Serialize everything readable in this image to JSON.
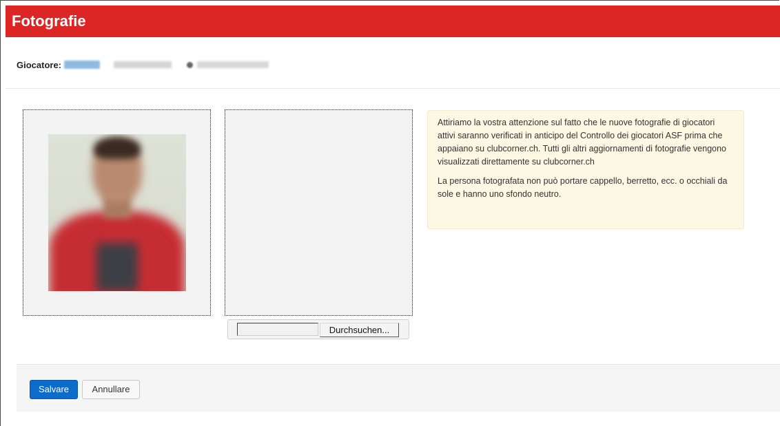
{
  "header": {
    "title": "Fotografie"
  },
  "player": {
    "label": "Giocatore:"
  },
  "upload": {
    "browse_label": "Durchsuchen..."
  },
  "notice": {
    "paragraph_1": "Attiriamo la vostra attenzione sul fatto che le nuove fotografie di giocatori attivi saranno verificati in anticipo del Controllo dei giocatori ASF prima che appaiano su clubcorner.ch. Tutti gli altri aggiornamenti di fotografie vengono visualizzati direttamente su clubcorner.ch",
    "paragraph_2": "La persona fotografata non può portare cappello, berretto, ecc. o occhiali da sole e hanno uno sfondo neutro."
  },
  "footer": {
    "save_label": "Salvare",
    "cancel_label": "Annullare"
  },
  "colors": {
    "header_bg": "#dc2626",
    "primary_button": "#0d6bc9",
    "notice_bg": "#fcf8e3"
  }
}
